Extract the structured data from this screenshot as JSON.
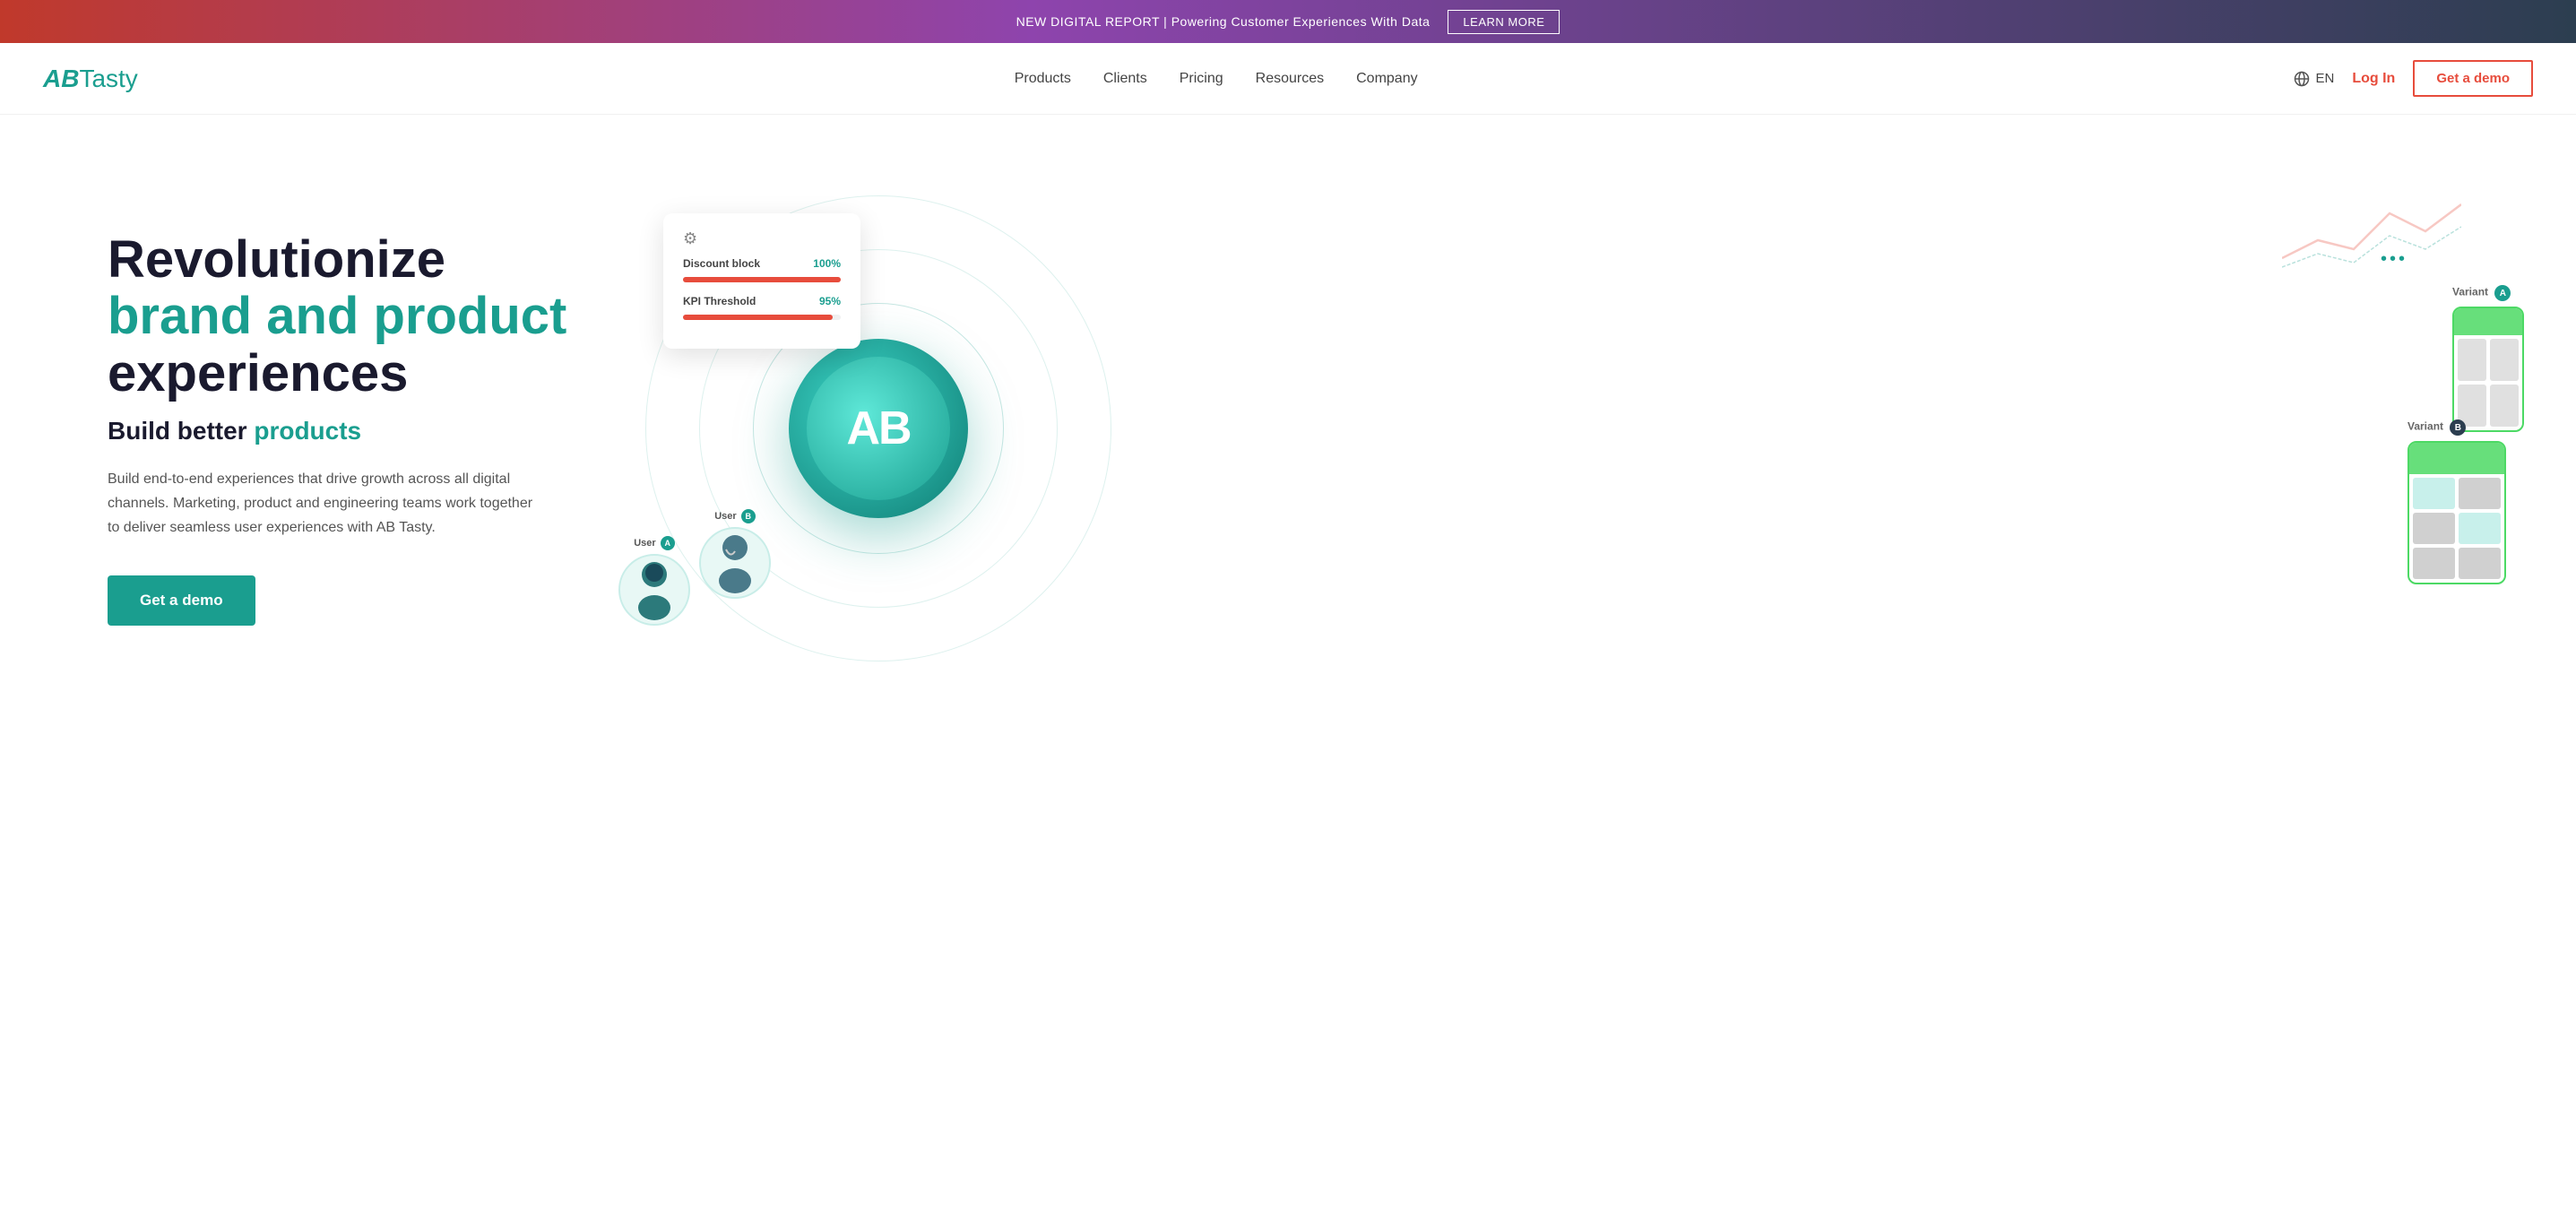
{
  "banner": {
    "text": "NEW DIGITAL REPORT | Powering Customer Experiences With Data",
    "cta": "LEARN MORE"
  },
  "nav": {
    "logo_ab": "AB",
    "logo_tasty": " Tasty",
    "links": [
      {
        "label": "Products",
        "href": "#"
      },
      {
        "label": "Clients",
        "href": "#"
      },
      {
        "label": "Pricing",
        "href": "#"
      },
      {
        "label": "Resources",
        "href": "#"
      },
      {
        "label": "Company",
        "href": "#"
      }
    ],
    "lang": "EN",
    "login": "Log In",
    "demo": "Get a demo"
  },
  "hero": {
    "title_line1": "Revolutionize",
    "title_line2": "brand and product",
    "title_line3": "experiences",
    "subtitle_prefix": "Build better ",
    "subtitle_highlight": "products",
    "description": "Build end-to-end experiences that drive growth across all digital channels. Marketing, product and engineering teams work together to deliver seamless user experiences with AB Tasty.",
    "cta": "Get a demo"
  },
  "illustration": {
    "ab_text": "AB",
    "metric1_label": "Discount block",
    "metric1_value": "100%",
    "metric1_fill": 100,
    "metric2_label": "KPI Threshold",
    "metric2_value": "95%",
    "metric2_fill": 95,
    "variant_a_label": "Variant",
    "variant_a_badge": "A",
    "variant_b_label": "Variant",
    "variant_b_badge": "B",
    "user_a_label": "User",
    "user_a_badge": "A",
    "user_b_label": "User",
    "user_b_badge": "B",
    "three_dots": "•••"
  },
  "colors": {
    "teal": "#1a9e8f",
    "red": "#e74c3c",
    "dark": "#1a1a2e",
    "green": "#4cd964"
  }
}
